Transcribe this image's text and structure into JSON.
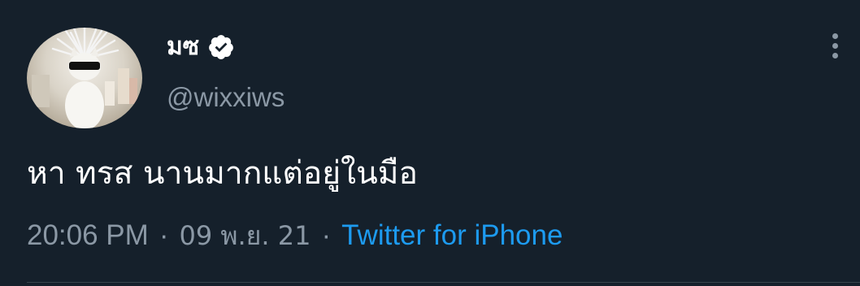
{
  "colors": {
    "background": "#15202b",
    "primary_text": "#ffffff",
    "secondary_text": "#8b98a5",
    "link": "#1d9bf0",
    "verified_badge": "#ffffff"
  },
  "author": {
    "display_name": "มซ",
    "handle": "@wixxiws",
    "verified": true,
    "avatar": "cat-with-wild-hair-and-sunglasses"
  },
  "tweet": {
    "text": "หา ทรส นานมากแต่อยู่ในมือ",
    "time": "20:06 PM",
    "date": "09 พ.ย. 21",
    "separator": "·",
    "source": "Twitter for iPhone"
  },
  "icons": {
    "more": "more-vertical-icon",
    "verified": "verified-badge-icon"
  }
}
